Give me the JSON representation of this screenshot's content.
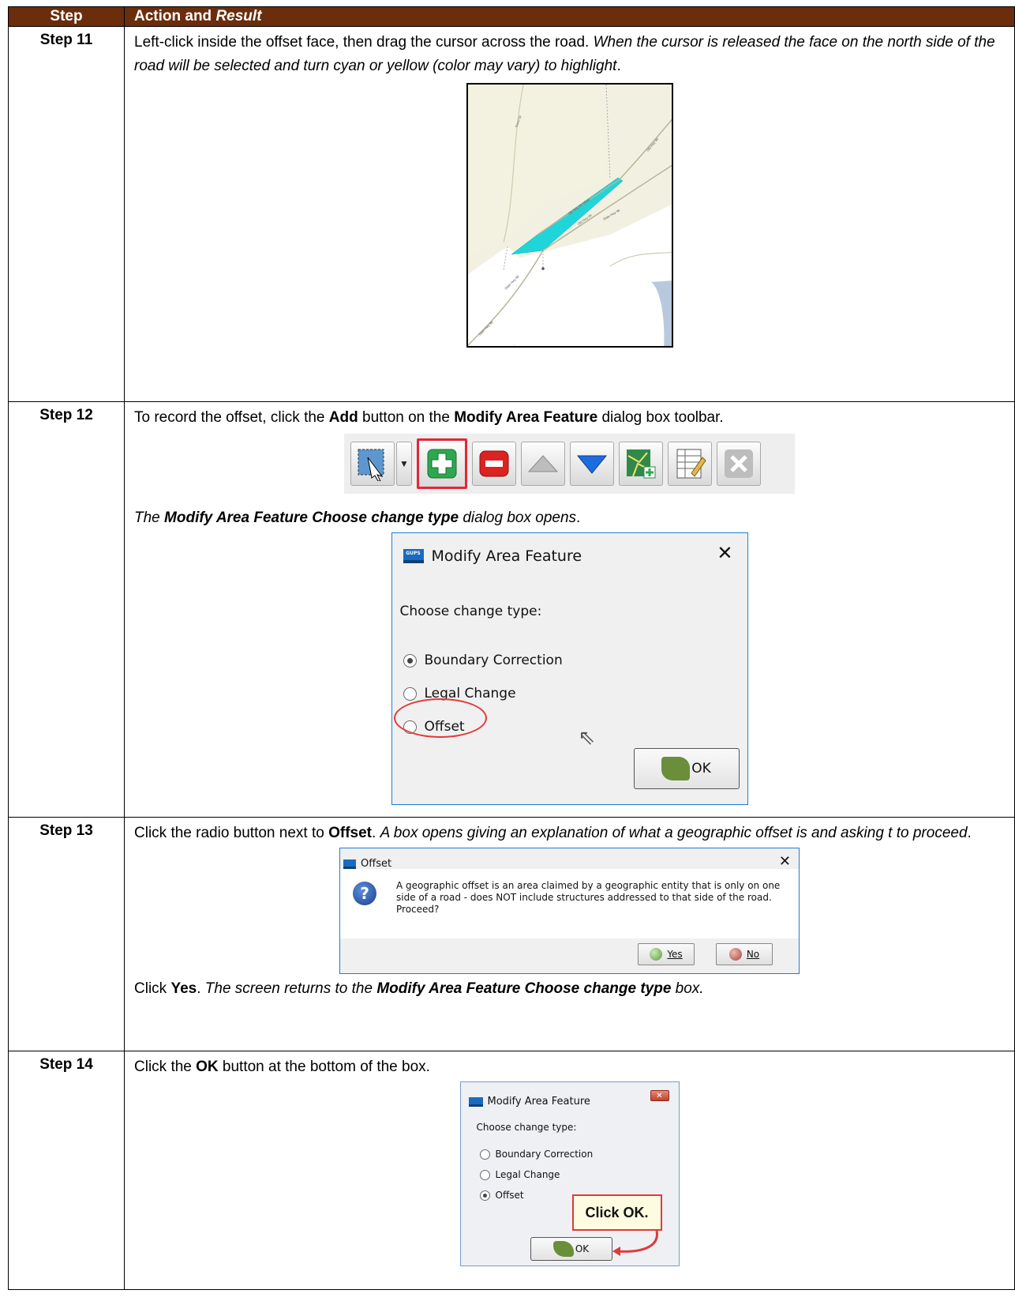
{
  "header": {
    "step": "Step",
    "action_plain": "Action and ",
    "action_italic": "Result"
  },
  "rows": [
    {
      "step": "Step 11",
      "text_plain": "Left-click inside the offset face, then drag the cursor across the road. ",
      "text_italic": "When the cursor is released the face on the north side of the road will be selected and turn cyan or yellow (color may vary) to highlight",
      "text_end": ".",
      "map": {
        "road_labels": [
          "Youco Dr",
          "Old Hwy 98 Offset",
          "Old Hwy 98",
          "Old Hwy 98",
          "State Hwy 98",
          "State Hwy 98",
          "State Hwy 98"
        ]
      }
    },
    {
      "step": "Step 12",
      "t1": "To record the offset, click the ",
      "b1": "Add",
      "t2": " button on the ",
      "b2": "Modify Area Feature",
      "t3": " dialog box toolbar.",
      "toolbar_icons": [
        "select-area-icon",
        "dropdown-icon",
        "add-icon",
        "remove-icon",
        "move-up-icon",
        "move-down-icon",
        "map-add-icon",
        "edit-table-icon",
        "close-icon"
      ],
      "after_i1": "The ",
      "after_bi": "Modify Area Feature Choose change type",
      "after_i2": " dialog box opens",
      "after_end": ".",
      "dialog": {
        "title": "Modify Area Feature",
        "close": "✕",
        "app_icon": "GUPS",
        "prompt": "Choose change type:",
        "options": [
          "Boundary Correction",
          "Legal Change",
          "Offset"
        ],
        "selected": "Boundary Correction",
        "ok": "OK"
      }
    },
    {
      "step": "Step 13",
      "t1": "Click the radio button next to ",
      "b1": "Offset",
      "t2": ". ",
      "i1": "A box opens giving an explanation of what a geographic offset is and asking t to proceed",
      "t3": ".",
      "dialog": {
        "title": "Offset",
        "close": "✕",
        "message": "A geographic offset is an area claimed by a geographic entity that is only on one side of a road - does NOT include structures addressed to that side of the road. Proceed?",
        "yes": "Yes",
        "no": "No"
      },
      "after_t1": "Click ",
      "after_b1": "Yes",
      "after_t2": ". ",
      "after_i1": "The screen returns to the ",
      "after_bi": "Modify Area Feature Choose change type",
      "after_i2": " box."
    },
    {
      "step": "Step 14",
      "t1": "Click the ",
      "b1": "OK",
      "t2": " button at the bottom of the box.",
      "dialog": {
        "title": "Modify Area Feature",
        "prompt": "Choose change type:",
        "options": [
          "Boundary Correction",
          "Legal Change",
          "Offset"
        ],
        "selected": "Offset",
        "callout": "Click OK.",
        "ok": "OK",
        "close": "✕"
      }
    }
  ],
  "colors": {
    "header_bg": "#6b2d0c",
    "highlight": "#1fd5d9",
    "callout_border": "#e03a3a"
  }
}
